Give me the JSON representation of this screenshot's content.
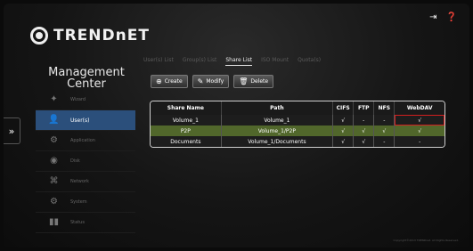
{
  "header": {
    "logo_text": "TRENDnET",
    "icons": [
      "logout-icon",
      "help-icon"
    ]
  },
  "sidebar": {
    "title_line1": "Management",
    "title_line2": "Center",
    "items": [
      {
        "label": "Wizard",
        "icon": "wand-icon"
      },
      {
        "label": "User(s)",
        "icon": "users-icon"
      },
      {
        "label": "Application",
        "icon": "gear-icon"
      },
      {
        "label": "Disk",
        "icon": "disk-icon"
      },
      {
        "label": "Network",
        "icon": "network-icon"
      },
      {
        "label": "System",
        "icon": "system-icon"
      },
      {
        "label": "Status",
        "icon": "status-icon"
      }
    ]
  },
  "expander_label": "»",
  "tabs": [
    {
      "label": "User(s) List"
    },
    {
      "label": "Group(s) List"
    },
    {
      "label": "Share List"
    },
    {
      "label": "ISO Mount"
    },
    {
      "label": "Quota(s)"
    }
  ],
  "toolbar": {
    "create": "Create",
    "modify": "Modify",
    "delete": "Delete"
  },
  "table": {
    "headers": [
      "Share Name",
      "Path",
      "CIFS",
      "FTP",
      "NFS",
      "WebDAV"
    ],
    "rows": [
      [
        "Volume_1",
        "Volume_1",
        "√",
        "-",
        "-",
        "√"
      ],
      [
        "P2P",
        "Volume_1/P2P",
        "√",
        "√",
        "√",
        "√"
      ],
      [
        "Documents",
        "Volume_1/Documents",
        "√",
        "√",
        "-",
        "-"
      ]
    ]
  },
  "footer": "Copyright©2013 TRENDnet. All Rights Reserved."
}
